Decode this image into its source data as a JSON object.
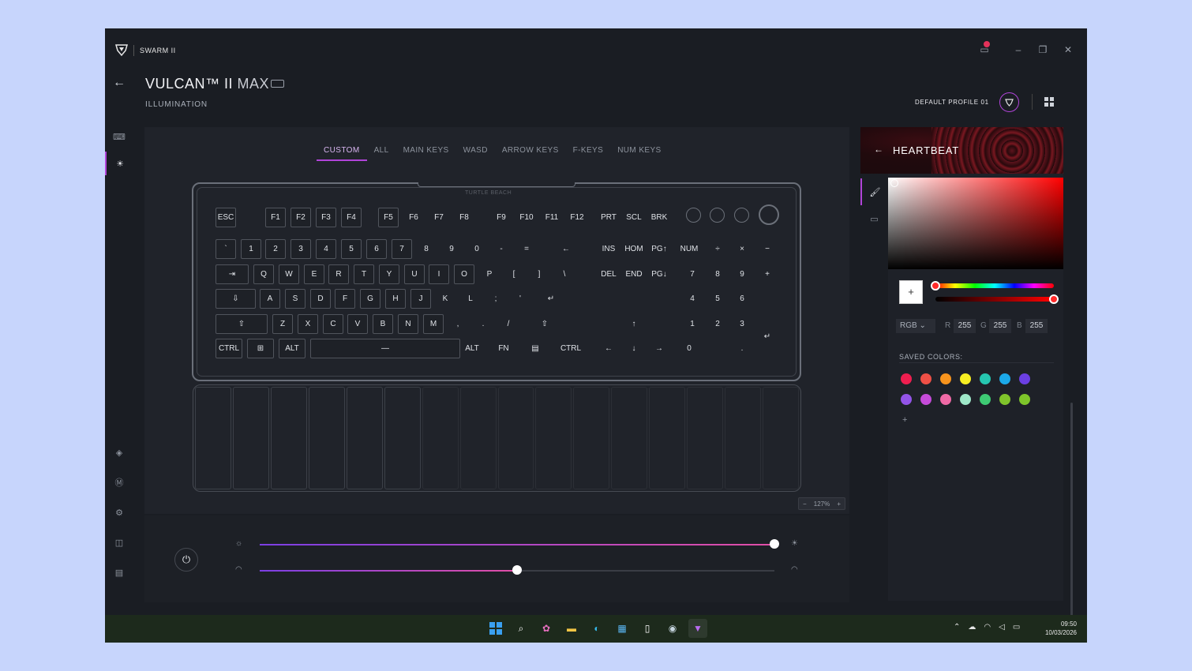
{
  "app": {
    "name": "SWARM II"
  },
  "header": {
    "device": "VULCAN™ II",
    "device_suffix": "MAX",
    "section": "ILLUMINATION",
    "profile": "DEFAULT PROFILE 01"
  },
  "tabs": [
    {
      "label": "CUSTOM",
      "active": true
    },
    {
      "label": "ALL"
    },
    {
      "label": "MAIN KEYS"
    },
    {
      "label": "WASD"
    },
    {
      "label": "ARROW KEYS"
    },
    {
      "label": "F-KEYS"
    },
    {
      "label": "NUM KEYS"
    }
  ],
  "keyboard": {
    "brand": "TURTLE BEACH",
    "row_fn": [
      "ESC",
      "F1",
      "F2",
      "F3",
      "F4",
      "F5",
      "F6",
      "F7",
      "F8",
      "F9",
      "F10",
      "F11",
      "F12",
      "PRT",
      "SCL",
      "BRK"
    ],
    "row_num": [
      "`",
      "1",
      "2",
      "3",
      "4",
      "5",
      "6",
      "7",
      "8",
      "9",
      "0",
      "-",
      "=",
      "←",
      "INS",
      "HOM",
      "PG↑",
      "NUM",
      "÷",
      "×",
      "−"
    ],
    "row_q": [
      "⇥",
      "Q",
      "W",
      "E",
      "R",
      "T",
      "Y",
      "U",
      "I",
      "O",
      "P",
      "[",
      "]",
      "\\",
      "DEL",
      "END",
      "PG↓",
      "7",
      "8",
      "9",
      "+"
    ],
    "row_a": [
      "⇩",
      "A",
      "S",
      "D",
      "F",
      "G",
      "H",
      "J",
      "K",
      "L",
      ";",
      "'",
      "↵",
      "4",
      "5",
      "6"
    ],
    "row_z": [
      "⇧",
      "Z",
      "X",
      "C",
      "V",
      "B",
      "N",
      "M",
      ",",
      ".",
      "/",
      "⇧",
      "↑",
      "1",
      "2",
      "3",
      "↵"
    ],
    "row_ctrl": [
      "CTRL",
      "⊞",
      "ALT",
      "—",
      "ALT",
      "FN",
      "▤",
      "CTRL",
      "←",
      "↓",
      "→",
      "0",
      "."
    ]
  },
  "zoom": {
    "minus": "−",
    "value": "127%",
    "plus": "+"
  },
  "sliders": {
    "brightness": 100,
    "speed": 50
  },
  "effect": {
    "title": "HEARTBEAT",
    "color_mode": "RGB",
    "r_label": "R",
    "r": "255",
    "g_label": "G",
    "g": "255",
    "b_label": "B",
    "b": "255",
    "hue_position": 0,
    "alpha_position": 1,
    "saved_label": "SAVED COLORS:",
    "saved_colors": [
      "#ee1e4f",
      "#ef5046",
      "#f7941d",
      "#f7ee22",
      "#26c6b0",
      "#1ba9e9",
      "#6b3fe3",
      "#9354e8",
      "#c54bd9",
      "#f06aa6",
      "#9fe8c9",
      "#3ecb74",
      "#80c42b",
      "#7ec52a"
    ],
    "add_label": "+"
  },
  "taskbar": {
    "time": "09:50",
    "date": "10/03/2026"
  }
}
